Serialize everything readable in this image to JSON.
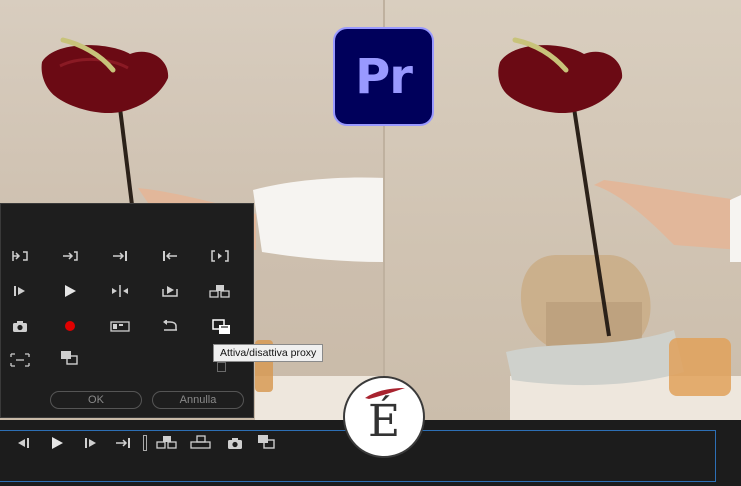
{
  "branding": {
    "app_logo_text": "Pr",
    "site_logo_letter": "É",
    "colors": {
      "premiere_bg": "#00005b",
      "premiere_text": "#9999ff",
      "accent_red": "#e00000",
      "panel_bg": "#1e1e1e",
      "timeline_border": "#2d6fb5"
    }
  },
  "button_editor": {
    "rows": [
      [
        "mark-in-icon",
        "mark-out-icon",
        "go-to-out-icon",
        "go-to-in-icon",
        "clear-in-out-icon"
      ],
      [
        "step-back-icon",
        "play-icon",
        "trim-icon",
        "export-frame-icon",
        "insert-icon"
      ],
      [
        "camera-icon",
        "record-icon",
        "multicam-icon",
        "loop-icon",
        "toggle-proxy-icon"
      ],
      [
        "safe-margins-icon",
        "overlay-icon"
      ]
    ],
    "ok_label": "OK",
    "cancel_label": "Annulla",
    "tooltip": "Attiva/disattiva proxy"
  },
  "transport_bar": {
    "icons": [
      "step-back-icon",
      "play-icon",
      "step-forward-icon",
      "go-to-out-icon",
      "separator",
      "insert-icon",
      "overwrite-icon",
      "camera-icon",
      "toggle-proxy-icon"
    ]
  }
}
